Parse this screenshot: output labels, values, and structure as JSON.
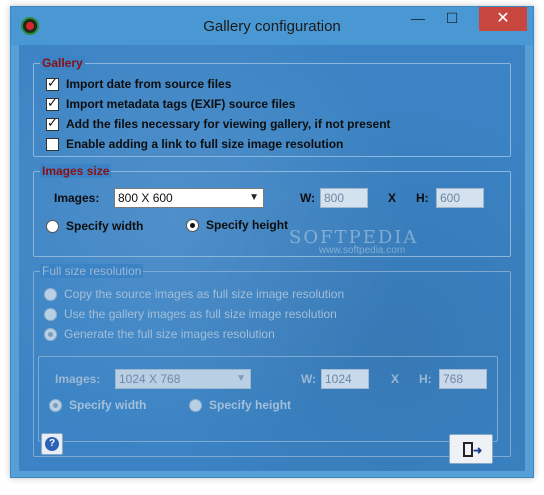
{
  "window": {
    "title": "Gallery configuration",
    "minimize_glyph": "—",
    "maximize_glyph": "☐",
    "close_glyph": "✕"
  },
  "gallery": {
    "legend": "Gallery",
    "options": [
      {
        "label": "Import date from source files",
        "checked": true
      },
      {
        "label": "Import metadata tags (EXIF) source files",
        "checked": true
      },
      {
        "label": "Add the files necessary for viewing gallery, if not present",
        "checked": true
      },
      {
        "label": "Enable adding a link to full size image resolution",
        "checked": false
      }
    ]
  },
  "images_size": {
    "legend": "Images size",
    "images_label": "Images:",
    "images_value": "800 X 600",
    "w_label": "W:",
    "w_value": "800",
    "x_label": "X",
    "h_label": "H:",
    "h_value": "600",
    "radio_width": "Specify width",
    "radio_height": "Specify height",
    "selected": "height"
  },
  "full_size": {
    "legend": "Full size resolution",
    "options": [
      {
        "label": "Copy the source images as full size image resolution",
        "selected": false
      },
      {
        "label": "Use the gallery images as full size image resolution",
        "selected": false
      },
      {
        "label": "Generate the full size images resolution",
        "selected": true
      }
    ],
    "images_label": "Images:",
    "images_value": "1024 X 768",
    "w_label": "W:",
    "w_value": "1024",
    "x_label": "X",
    "h_label": "H:",
    "h_value": "768",
    "radio_width": "Specify width",
    "radio_height": "Specify height",
    "selected": "width",
    "enabled": false
  },
  "footer": {
    "help_glyph": "?",
    "exit_glyph": "➜"
  },
  "watermark": {
    "text": "SOFTPEDIA",
    "sub": "www.softpedia.com"
  },
  "colors": {
    "window_bg": "#55a0d6",
    "client_bg": "#3b83c4",
    "legend_red": "#8b0f16",
    "close_red": "#c7463e"
  }
}
